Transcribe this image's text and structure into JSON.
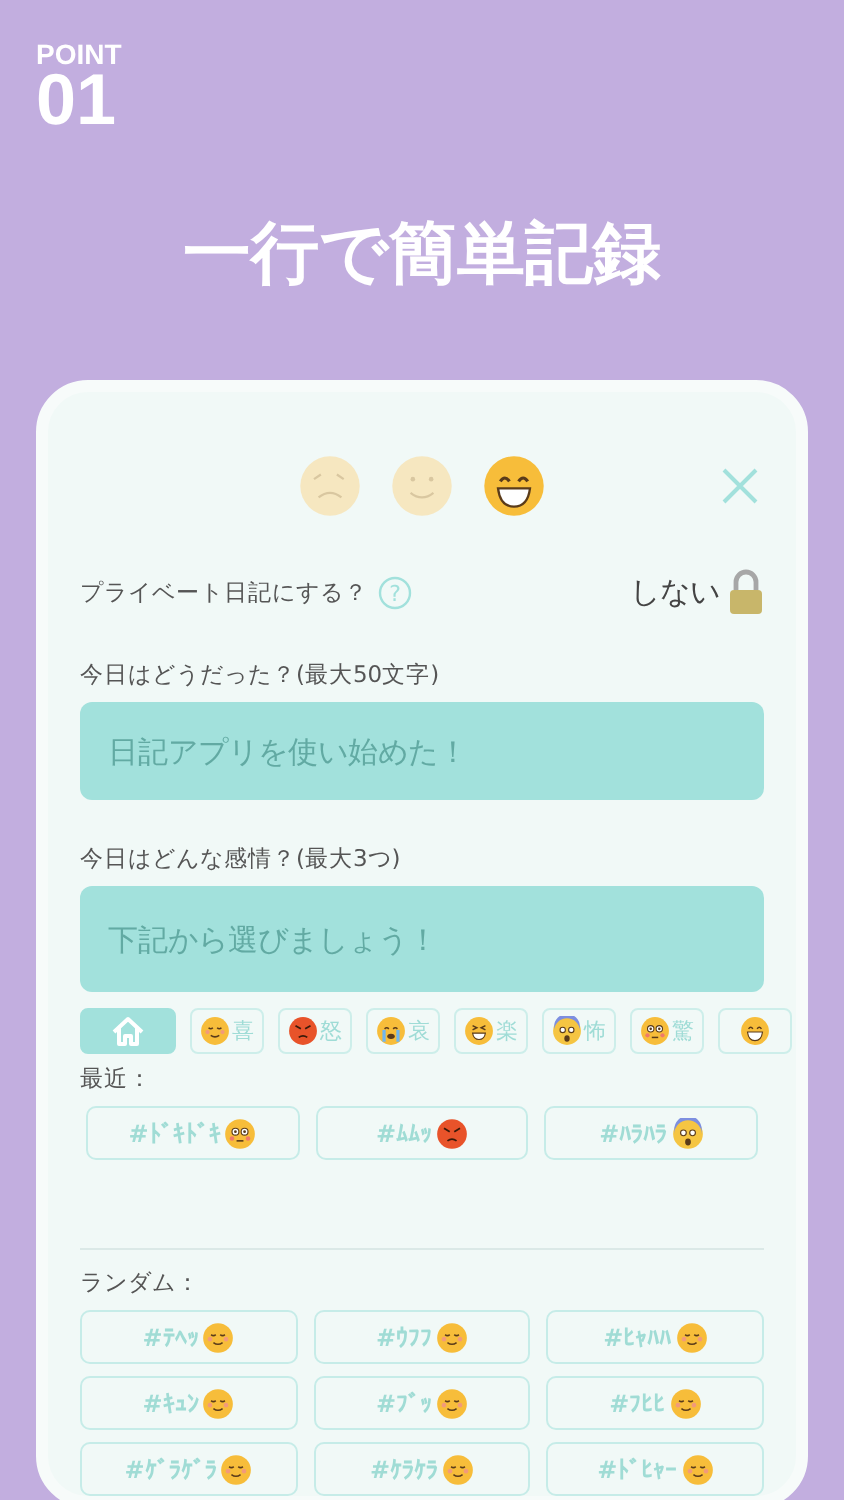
{
  "header": {
    "label": "POINT",
    "number": "01",
    "title": "一行で簡単記録"
  },
  "moods": [
    {
      "kind": "sad",
      "selected": false
    },
    {
      "kind": "calm",
      "selected": false
    },
    {
      "kind": "grin",
      "selected": true
    }
  ],
  "private": {
    "label": "プライベート日記にする？",
    "help": "?",
    "value": "しない",
    "locked": true
  },
  "diary": {
    "label": "今日はどうだった？(最大50文字)",
    "placeholder": "日記アプリを使い始めた！"
  },
  "emotion": {
    "label": "今日はどんな感情？(最大3つ)",
    "placeholder": "下記から選びましょう！"
  },
  "categories": [
    {
      "kind": "home",
      "selected": true
    },
    {
      "kind": "relieved",
      "label": "喜",
      "selected": false
    },
    {
      "kind": "angry",
      "label": "怒",
      "selected": false
    },
    {
      "kind": "crying",
      "label": "哀",
      "selected": false
    },
    {
      "kind": "laugh",
      "label": "楽",
      "selected": false
    },
    {
      "kind": "scream",
      "label": "怖",
      "selected": false
    },
    {
      "kind": "flushed",
      "label": "驚",
      "selected": false
    },
    {
      "kind": "grin",
      "selected": false
    }
  ],
  "recent": {
    "label": "最近：",
    "tags": [
      {
        "text": "#ﾄﾞｷﾄﾞｷ",
        "kind": "flushed"
      },
      {
        "text": "#ﾑﾑｯ",
        "kind": "angry"
      },
      {
        "text": "#ﾊﾗﾊﾗ",
        "kind": "scream"
      }
    ]
  },
  "random": {
    "label": "ランダム：",
    "tags": [
      {
        "text": "#ﾃﾍｯ",
        "kind": "relieved"
      },
      {
        "text": "#ｳﾌﾌ",
        "kind": "relieved"
      },
      {
        "text": "#ﾋｬﾊﾊ",
        "kind": "relieved"
      },
      {
        "text": "#ｷｭﾝ",
        "kind": "relieved"
      },
      {
        "text": "#ﾌﾞｯ",
        "kind": "relieved"
      },
      {
        "text": "#ﾌﾋﾋ",
        "kind": "relieved"
      },
      {
        "text": "#ｹﾞﾗｹﾞﾗ",
        "kind": "relieved"
      },
      {
        "text": "#ｹﾗｹﾗ",
        "kind": "relieved"
      },
      {
        "text": "#ﾄﾞﾋｬｰ",
        "kind": "relieved"
      }
    ]
  }
}
